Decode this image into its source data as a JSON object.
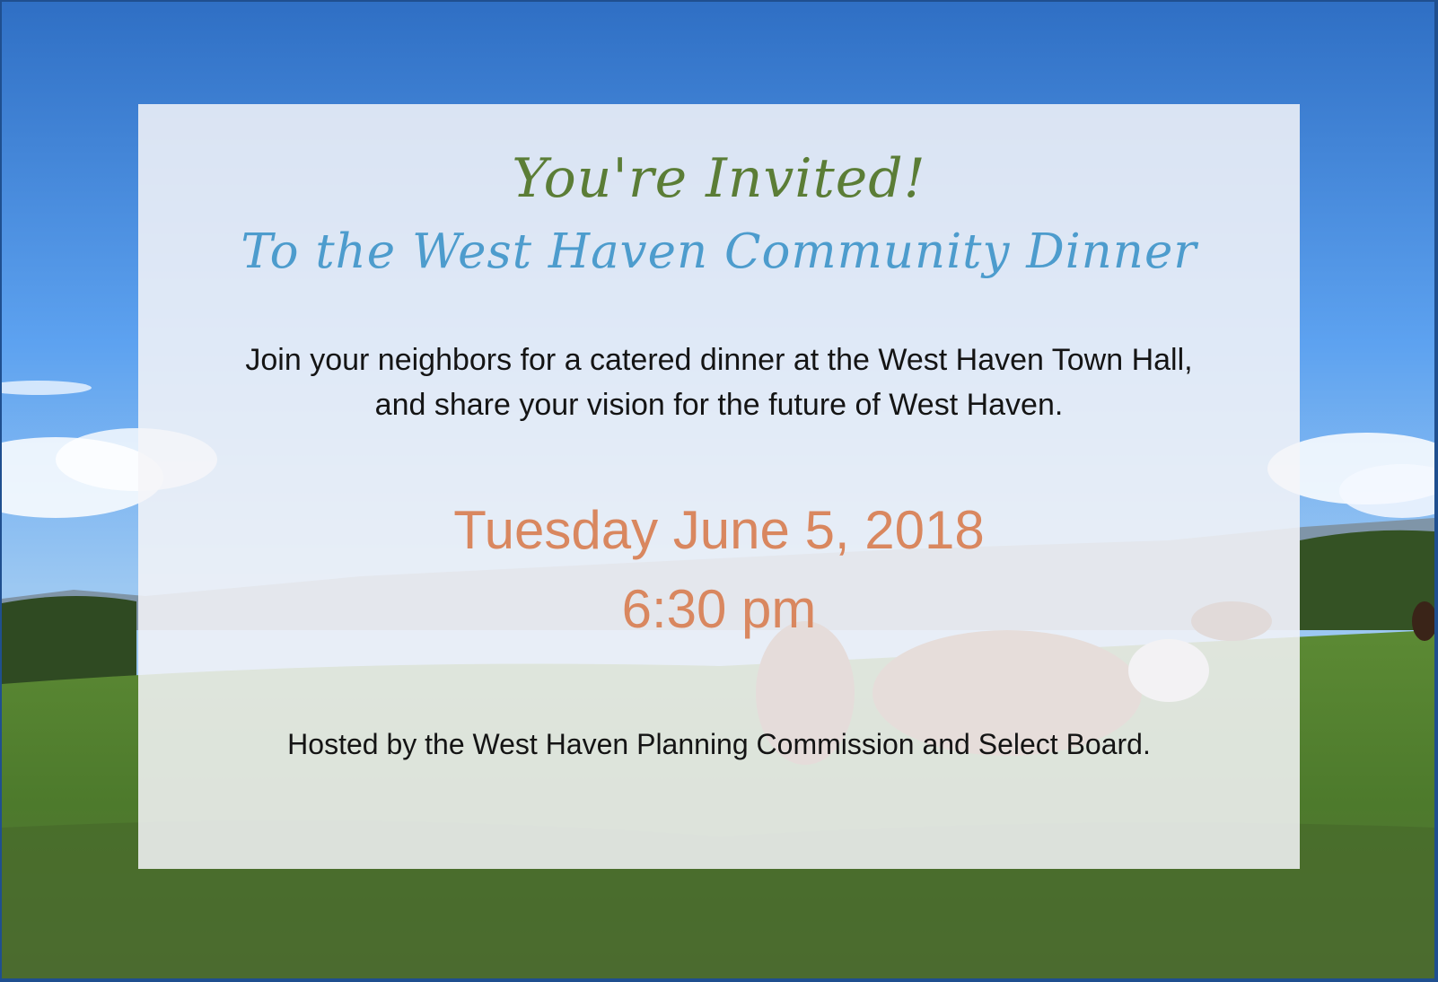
{
  "invitation": {
    "title": "You're Invited!",
    "subtitle": "To the West Haven Community Dinner",
    "body_line1": "Join your neighbors for a catered dinner at the West Haven Town Hall,",
    "body_line2": "and share your vision for the future of West Haven.",
    "date": "Tuesday June 5, 2018",
    "time": "6:30 pm",
    "host": "Hosted by the West Haven Planning Commission and Select Board."
  },
  "colors": {
    "title": "#5b7d36",
    "subtitle": "#4d9ccd",
    "body": "#141414",
    "date_time": "#d9875f",
    "sky": "#5fa2ee",
    "field": "#4d7a2c"
  }
}
